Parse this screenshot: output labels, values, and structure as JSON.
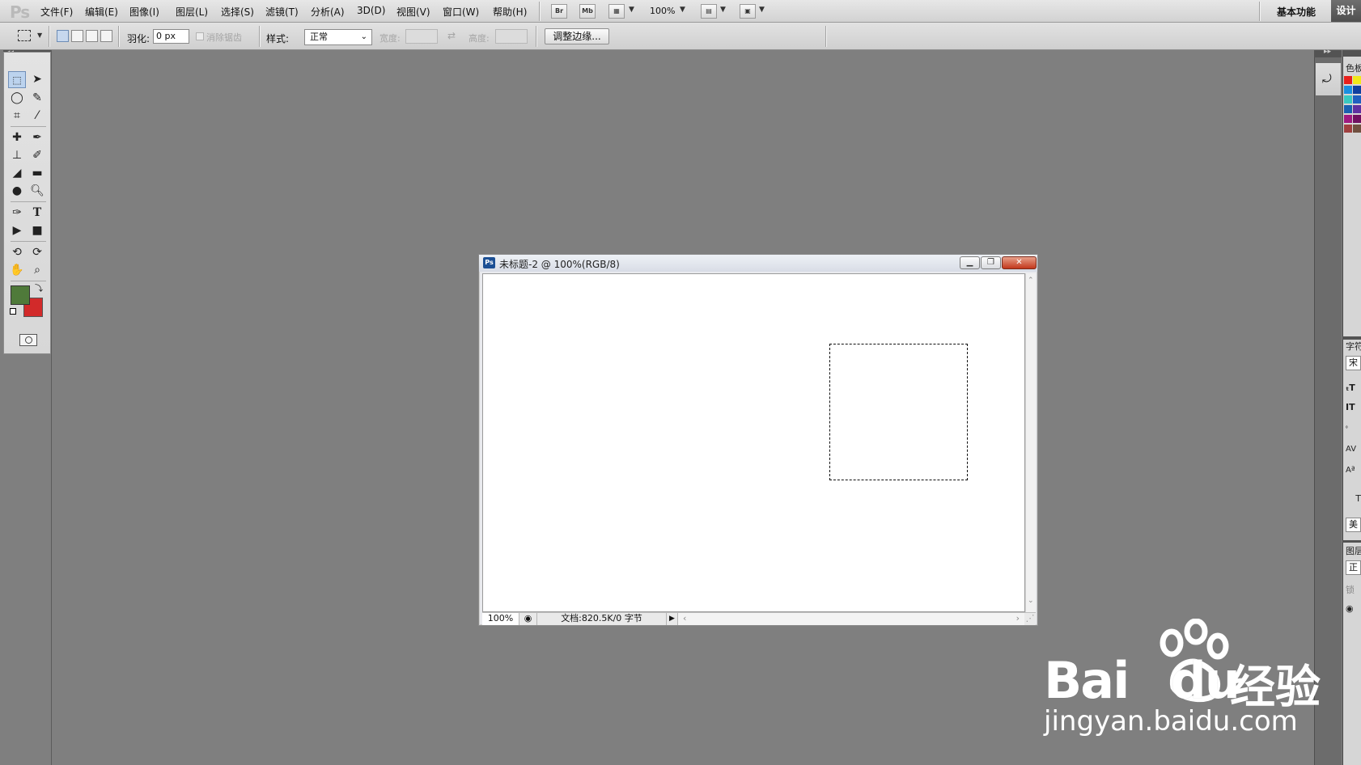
{
  "app": {
    "logo": "Ps"
  },
  "menu": [
    "文件(F)",
    "编辑(E)",
    "图像(I)",
    "图层(L)",
    "选择(S)",
    "滤镜(T)",
    "分析(A)",
    "3D(D)",
    "视图(V)",
    "窗口(W)",
    "帮助(H)"
  ],
  "menubar": {
    "bridge": "Br",
    "minibridge": "Mb",
    "zoom": "100%",
    "workspace_essentials": "基本功能",
    "workspace_design": "设计"
  },
  "options": {
    "feather_label": "羽化:",
    "feather_value": "0 px",
    "antialias_label": "消除锯齿",
    "style_label": "样式:",
    "style_value": "正常",
    "width_label": "宽度:",
    "height_label": "高度:",
    "refine_edge": "调整边缘..."
  },
  "document": {
    "title": "未标题-2 @ 100%(RGB/8)",
    "zoom": "100%",
    "info": "文档:820.5K/0 字节"
  },
  "right_panel": {
    "color_tab": "色板",
    "char_tab": "字符",
    "font_field": "宋",
    "lang_field": "美",
    "layers_tab": "图层",
    "blend_field": "正",
    "lock_label": "锁"
  },
  "colors": {
    "foreground": "#4f7a3a",
    "background": "#d22a2a",
    "swatches": [
      "#e8201c",
      "#f0e81a",
      "#1a8fe0",
      "#1040a0",
      "#38c8c0",
      "#2060c0",
      "#1a60b0",
      "#6030a0",
      "#a01a80",
      "#701060",
      "#a04040",
      "#705040"
    ]
  },
  "watermark": {
    "brand": "Bai",
    "brand2": "du",
    "cn": "经验",
    "url": "jingyan.baidu.com"
  }
}
